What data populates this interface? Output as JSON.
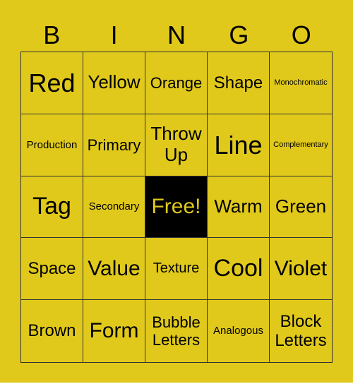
{
  "header": [
    "B",
    "I",
    "N",
    "G",
    "O"
  ],
  "cells": [
    "Red",
    "Yellow",
    "Orange",
    "Shape",
    "Monochromatic",
    "Production",
    "Primary",
    "Throw Up",
    "Line",
    "Complementary",
    "Tag",
    "Secondary",
    "Free!",
    "Warm",
    "Green",
    "Space",
    "Value",
    "Texture",
    "Cool",
    "Violet",
    "Brown",
    "Form",
    "Bubble Letters",
    "Analogous",
    "Block Letters"
  ],
  "colors": {
    "background": "#e0c91b",
    "free_cell": "#000000",
    "free_text": "#e0c91b"
  }
}
